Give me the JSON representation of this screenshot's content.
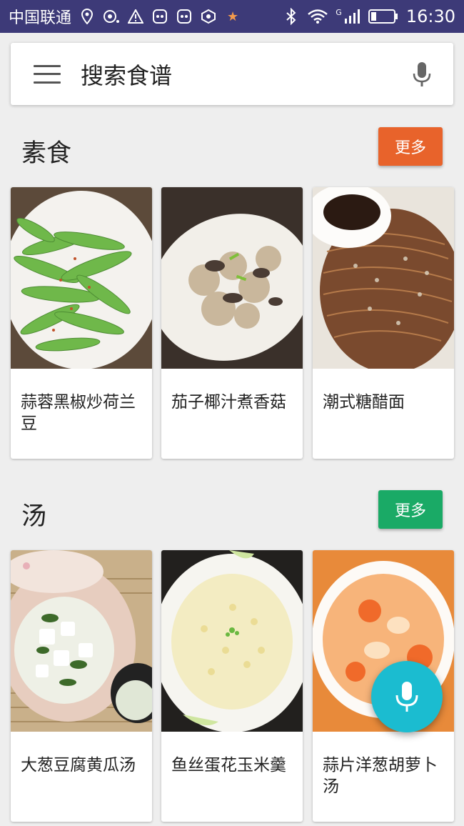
{
  "status_bar": {
    "carrier": "中国联通",
    "network": "G",
    "time": "16:30",
    "left_icons": [
      "location-icon",
      "hotspot-icon",
      "warning-icon",
      "app-notification-icon",
      "app-notification-icon",
      "app-notification-icon",
      "star-icon"
    ],
    "right_icons": [
      "bluetooth-icon",
      "wifi-icon",
      "signal-icon",
      "battery-icon"
    ]
  },
  "search": {
    "label": "搜索食谱",
    "menu_icon": "menu-icon",
    "mic_icon": "mic-icon"
  },
  "sections": [
    {
      "title": "素食",
      "more_label": "更多",
      "more_color": "#e8632b",
      "cards": [
        {
          "name": "蒜蓉黑椒炒荷兰豆"
        },
        {
          "name": "茄子椰汁煮香菇"
        },
        {
          "name": "潮式糖醋面"
        }
      ]
    },
    {
      "title": "汤",
      "more_label": "更多",
      "more_color": "#1aaa66",
      "cards": [
        {
          "name": "大葱豆腐黄瓜汤"
        },
        {
          "name": "鱼丝蛋花玉米羹"
        },
        {
          "name": "蒜片洋葱胡萝卜汤"
        }
      ]
    }
  ],
  "fab": {
    "icon": "mic-icon",
    "color": "#1bbcd0"
  }
}
